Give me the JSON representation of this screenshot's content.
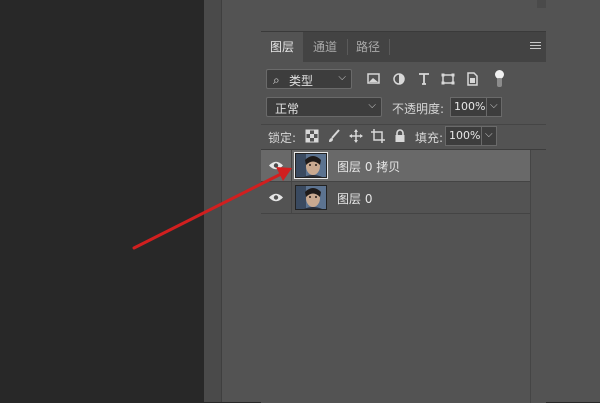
{
  "panel": {
    "tabs": [
      {
        "label": "图层",
        "active": true
      },
      {
        "label": "通道",
        "active": false
      },
      {
        "label": "路径",
        "active": false
      }
    ],
    "menu_icon": "panel-menu-icon"
  },
  "filter": {
    "type_label": "类型",
    "icons": [
      "image-filter-icon",
      "adjustment-filter-icon",
      "type-filter-icon",
      "shape-filter-icon",
      "smart-object-filter-icon"
    ]
  },
  "blend": {
    "mode": "正常",
    "opacity_label": "不透明度:",
    "opacity_value": "100%"
  },
  "lock": {
    "label": "锁定:",
    "icons": [
      "lock-transparent-pixels-icon",
      "lock-image-pixels-icon",
      "lock-position-icon",
      "lock-artboard-icon",
      "lock-all-icon"
    ],
    "fill_label": "填充:",
    "fill_value": "100%"
  },
  "layers": [
    {
      "name": "图层 0 拷贝",
      "visible": true,
      "selected": true
    },
    {
      "name": "图层 0",
      "visible": true,
      "selected": false
    }
  ],
  "colors": {
    "accent_arrow": "#d11f1f",
    "panel_bg": "#535353",
    "selected_row": "#696969"
  }
}
